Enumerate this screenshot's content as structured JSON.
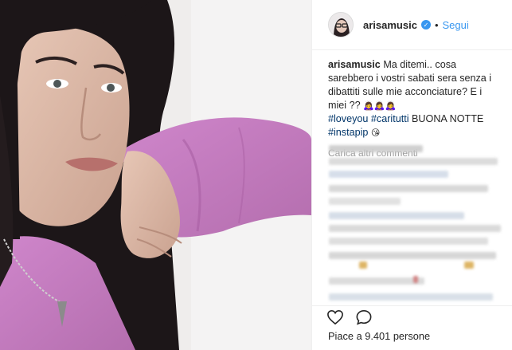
{
  "post": {
    "username": "arisamusic",
    "verified_mark": "✓",
    "separator": "•",
    "follow_label": "Segui"
  },
  "caption": {
    "author": "arisamusic",
    "text": "Ma ditemi.. cosa sarebbero i vostri sabati sera senza i dibattiti sulle mie acconciature? E i miei ??",
    "emojis": "🙇‍♀️🙇‍♀️🙇‍♀️",
    "hashtags": [
      "#loveyou",
      "#caritutti"
    ],
    "tail": "BUONA NOTTE",
    "hashtag_last": "#instapip",
    "end_emoji": "😘"
  },
  "comments": {
    "load_more_label": "Carica altri commenti"
  },
  "actions": {
    "like_icon": "heart-icon",
    "comment_icon": "comment-bubble-icon"
  },
  "likes": {
    "label": "Piace a 9.401 persone"
  },
  "colors": {
    "link_blue": "#3897f0",
    "hashtag_blue": "#003569",
    "sweater_pink": "#c77bc3",
    "hair": "#1c1618"
  }
}
